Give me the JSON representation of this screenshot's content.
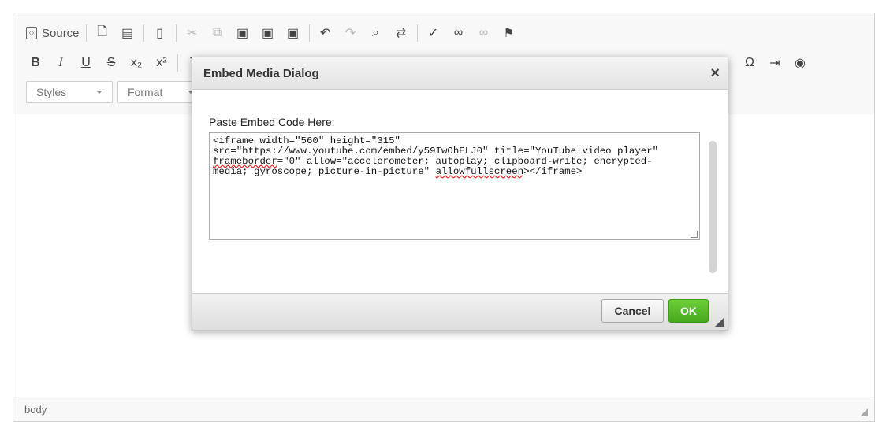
{
  "toolbar": {
    "source_label": "Source",
    "styles_label": "Styles",
    "format_label": "Format",
    "omega": "Ω"
  },
  "dialog": {
    "title": "Embed Media Dialog",
    "close": "×",
    "field_label": "Paste Embed Code Here:",
    "code_l1": "<iframe width=\"560\" height=\"315\"",
    "code_l2": "src=\"https://www.youtube.com/embed/y59IwOhELJ0\" title=\"YouTube video player\"",
    "code_l3a": "frameborder",
    "code_l3b": "=\"0\" allow=\"accelerometer; autoplay; clipboard-write; encrypted-",
    "code_l4a": "media; gyroscope; picture-in-picture\" ",
    "code_l4b": "allowfullscreen",
    "code_l4c": "></iframe>",
    "cancel": "Cancel",
    "ok": "OK"
  },
  "statusbar": {
    "path": "body"
  }
}
